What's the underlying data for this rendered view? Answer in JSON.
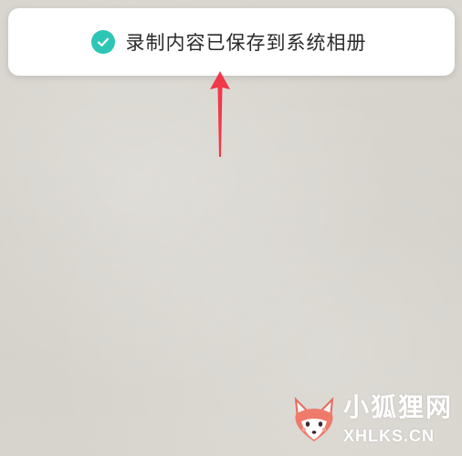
{
  "toast": {
    "message": "录制内容已保存到系统相册",
    "icon": "check-circle-icon",
    "icon_color": "#2dc6b6"
  },
  "annotation": {
    "arrow_color": "#f0394a"
  },
  "watermark": {
    "title": "小狐狸网",
    "domain": "XHLKS.CN",
    "logo_icon": "fox-logo-icon"
  }
}
